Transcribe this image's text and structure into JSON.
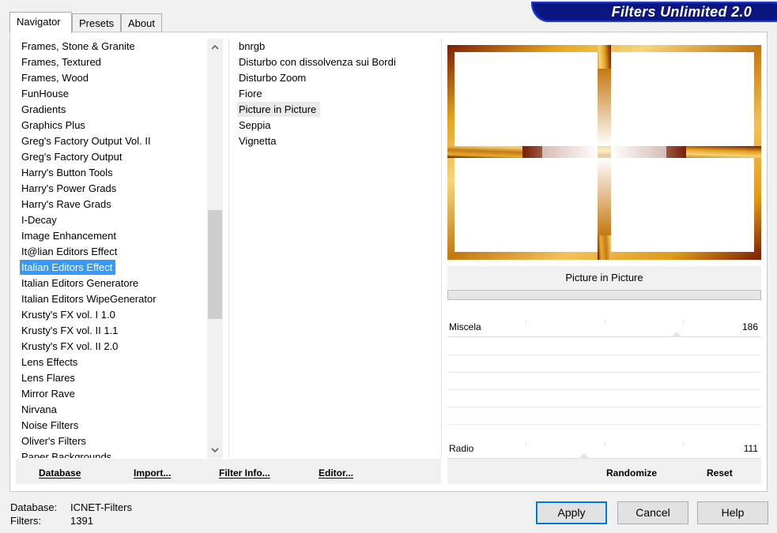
{
  "brand": {
    "title": "Filters Unlimited 2.0"
  },
  "tabs": [
    {
      "label": "Navigator",
      "active": true
    },
    {
      "label": "Presets",
      "active": false
    },
    {
      "label": "About",
      "active": false
    }
  ],
  "categories": [
    "Frames, Stone & Granite",
    "Frames, Textured",
    "Frames, Wood",
    "FunHouse",
    "Gradients",
    "Graphics Plus",
    "Greg's Factory Output Vol. II",
    "Greg's Factory Output",
    "Harry's Button Tools",
    "Harry's Power Grads",
    "Harry's Rave Grads",
    "I-Decay",
    "Image Enhancement",
    "It@lian Editors Effect",
    "Italian Editors Effect",
    "Italian Editors Generatore",
    "Italian Editors WipeGenerator",
    "Krusty's FX vol. I 1.0",
    "Krusty's FX vol. II 1.1",
    "Krusty's FX vol. II 2.0",
    "Lens Effects",
    "Lens Flares",
    "Mirror Rave",
    "Nirvana",
    "Noise Filters",
    "Oliver's Filters",
    "Paper Backgrounds"
  ],
  "selected_category": "Italian Editors Effect",
  "filters": [
    "bnrgb",
    "Disturbo con dissolvenza sui Bordi",
    "Disturbo Zoom",
    "Fiore",
    "Picture in Picture",
    "Seppia",
    "Vignetta"
  ],
  "highlighted_filter": "Picture in Picture",
  "preview": {
    "filter_name": "Picture in Picture",
    "frame_colors": {
      "gold": "#e2a21a",
      "dark": "#6b1a08",
      "light": "#f5d27a"
    }
  },
  "sliders": [
    {
      "label": "Miscela",
      "value": "186",
      "fraction": 0.73
    },
    {
      "label": "Radio",
      "value": "111",
      "fraction": 0.435
    }
  ],
  "toolbar_left": {
    "database": "Database",
    "import": "Import...",
    "filter_info": "Filter Info...",
    "editor": "Editor..."
  },
  "toolbar_right": {
    "randomize": "Randomize",
    "reset": "Reset"
  },
  "status": {
    "database_label": "Database:",
    "database_value": "ICNET-Filters",
    "filters_label": "Filters:",
    "filters_value": "1391"
  },
  "buttons": {
    "apply": "Apply",
    "cancel": "Cancel",
    "help": "Help"
  },
  "colors": {
    "selection": "#3399ff",
    "brand_bg": "#0b1680",
    "default_button_border": "#0078d7"
  }
}
